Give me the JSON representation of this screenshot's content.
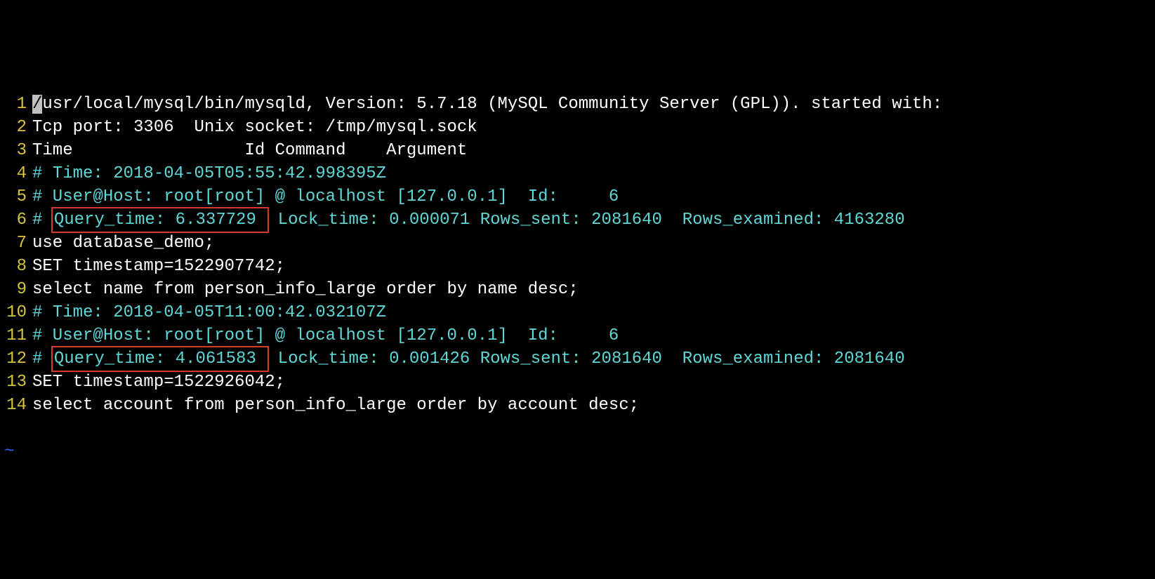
{
  "lines": [
    {
      "num": "1",
      "segments": [
        {
          "cls": "cursor",
          "text": "/"
        },
        {
          "cls": "white",
          "text": "usr/local/mysql/bin/mysqld, Version: 5.7.18 (MySQL Community Server (GPL)). started with:"
        }
      ]
    },
    {
      "num": "2",
      "segments": [
        {
          "cls": "white",
          "text": "Tcp port: 3306  Unix socket: /tmp/mysql.sock"
        }
      ]
    },
    {
      "num": "3",
      "segments": [
        {
          "cls": "white",
          "text": "Time                 Id Command    Argument"
        }
      ]
    },
    {
      "num": "4",
      "segments": [
        {
          "cls": "cyan",
          "text": "# Time: 2018-04-05T05:55:42.998395Z"
        }
      ]
    },
    {
      "num": "5",
      "segments": [
        {
          "cls": "cyan",
          "text": "# User@Host: root[root] @ localhost [127.0.0.1]  Id:     6"
        }
      ]
    },
    {
      "num": "6",
      "segments": [
        {
          "cls": "cyan",
          "text": "# "
        },
        {
          "cls": "cyan",
          "box": true,
          "text": "Query_time: 6.337729 "
        },
        {
          "cls": "cyan",
          "text": " Lock_time: 0.000071 Rows_sent: 2081640  Rows_examined: 4163280"
        }
      ]
    },
    {
      "num": "7",
      "segments": [
        {
          "cls": "white",
          "text": "use database_demo;"
        }
      ]
    },
    {
      "num": "8",
      "segments": [
        {
          "cls": "white",
          "text": "SET timestamp=1522907742;"
        }
      ]
    },
    {
      "num": "9",
      "segments": [
        {
          "cls": "white",
          "text": "select name from person_info_large order by name desc;"
        }
      ]
    },
    {
      "num": "10",
      "segments": [
        {
          "cls": "cyan",
          "text": "# Time: 2018-04-05T11:00:42.032107Z"
        }
      ]
    },
    {
      "num": "11",
      "segments": [
        {
          "cls": "cyan",
          "text": "# User@Host: root[root] @ localhost [127.0.0.1]  Id:     6"
        }
      ]
    },
    {
      "num": "12",
      "segments": [
        {
          "cls": "cyan",
          "text": "# "
        },
        {
          "cls": "cyan",
          "box": true,
          "text": "Query_time: 4.061583 "
        },
        {
          "cls": "cyan",
          "text": " Lock_time: 0.001426 Rows_sent: 2081640  Rows_examined: 2081640"
        }
      ]
    },
    {
      "num": "13",
      "segments": [
        {
          "cls": "white",
          "text": "SET timestamp=1522926042;"
        }
      ]
    },
    {
      "num": "14",
      "segments": [
        {
          "cls": "white",
          "text": "select account from person_info_large order by account desc;"
        }
      ]
    }
  ],
  "tilde": "~"
}
